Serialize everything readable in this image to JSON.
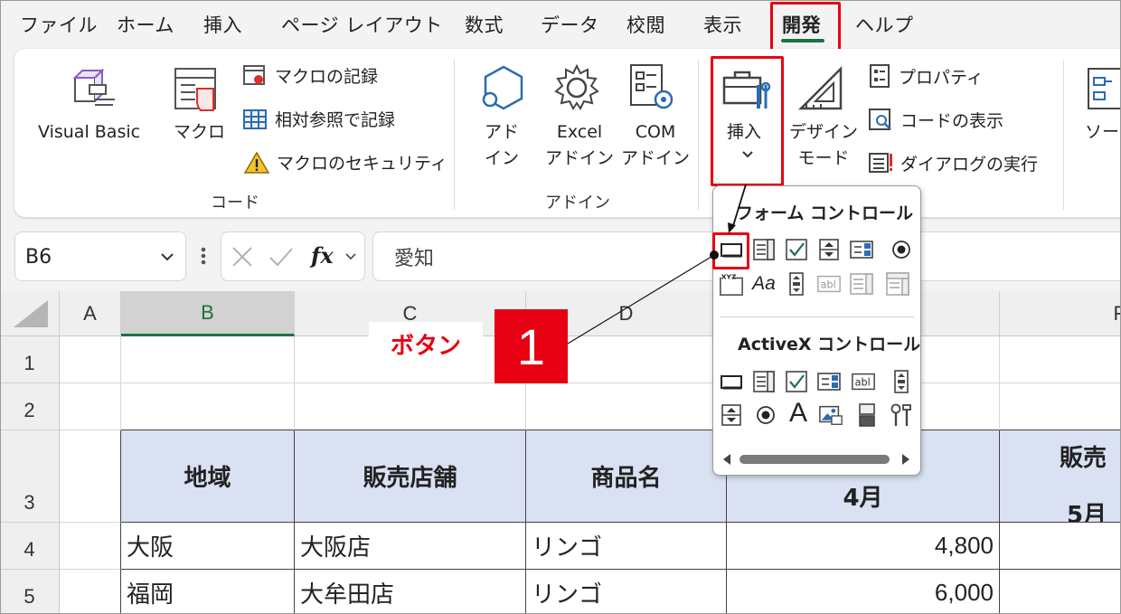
{
  "menu": {
    "tabs": [
      "ファイル",
      "ホーム",
      "挿入",
      "ページ レイアウト",
      "数式",
      "データ",
      "校閲",
      "表示",
      "開発",
      "ヘルプ"
    ],
    "active_tab": "開発"
  },
  "ribbon": {
    "code_group": {
      "label": "コード",
      "visual_basic": "Visual Basic",
      "macro": "マクロ",
      "record_macro": "マクロの記録",
      "relative_refs": "相対参照で記録",
      "macro_security": "マクロのセキュリティ"
    },
    "addin_group": {
      "label": "アドイン",
      "addins_line1": "アド",
      "addins_line2": "イン",
      "excel_addins_line1": "Excel",
      "excel_addins_line2": "アドイン",
      "com_addins_line1": "COM",
      "com_addins_line2": "アドイン"
    },
    "controls_group": {
      "insert": "挿入",
      "design_mode_line1": "デザイン",
      "design_mode_line2": "モード",
      "properties": "プロパティ",
      "view_code": "コードの表示",
      "run_dialog": "ダイアログの実行"
    },
    "source_partial": "ソー"
  },
  "formula_bar": {
    "name_box": "B6",
    "fx": "fx",
    "value": "愛知"
  },
  "sheet": {
    "columns": [
      "A",
      "B",
      "C",
      "D",
      "F"
    ],
    "rows": [
      "1",
      "2",
      "3",
      "4",
      "5"
    ],
    "header_row": {
      "region": "地域",
      "store": "販売店舗",
      "product": "商品名",
      "month_apr": "4月",
      "sales_partial": "販売",
      "month_may_partial": "5月"
    },
    "data_rows": [
      {
        "region": "大阪",
        "store": "大阪店",
        "product": "リンゴ",
        "apr": "4,800"
      },
      {
        "region": "福岡",
        "store": "大牟田店",
        "product": "リンゴ",
        "apr": "6,000"
      }
    ]
  },
  "insert_dropdown": {
    "form_controls_title": "フォーム コントロール",
    "activex_controls_title": "ActiveX コントロール",
    "form_icons": [
      "button-icon",
      "combo-box-icon",
      "checkbox-icon",
      "spin-button-icon",
      "list-box-icon",
      "option-button-icon",
      "group-box-icon",
      "label-icon",
      "scroll-bar-icon",
      "text-field-icon",
      "combo-list-edit-icon",
      "combo-dropdown-edit-icon"
    ],
    "activex_icons": [
      "command-button-icon",
      "combo-box-icon",
      "checkbox-icon",
      "list-box-icon",
      "text-box-icon",
      "scroll-bar-icon",
      "spin-button-icon",
      "option-button-icon",
      "label-icon",
      "image-icon",
      "toggle-button-icon",
      "more-controls-icon"
    ]
  },
  "annotation": {
    "label": "ボタン",
    "number": "1",
    "accent": "#e60012"
  },
  "colors": {
    "header_fill": "#d9e1f2",
    "excel_green": "#1e7145",
    "highlight_red": "#e60012"
  }
}
